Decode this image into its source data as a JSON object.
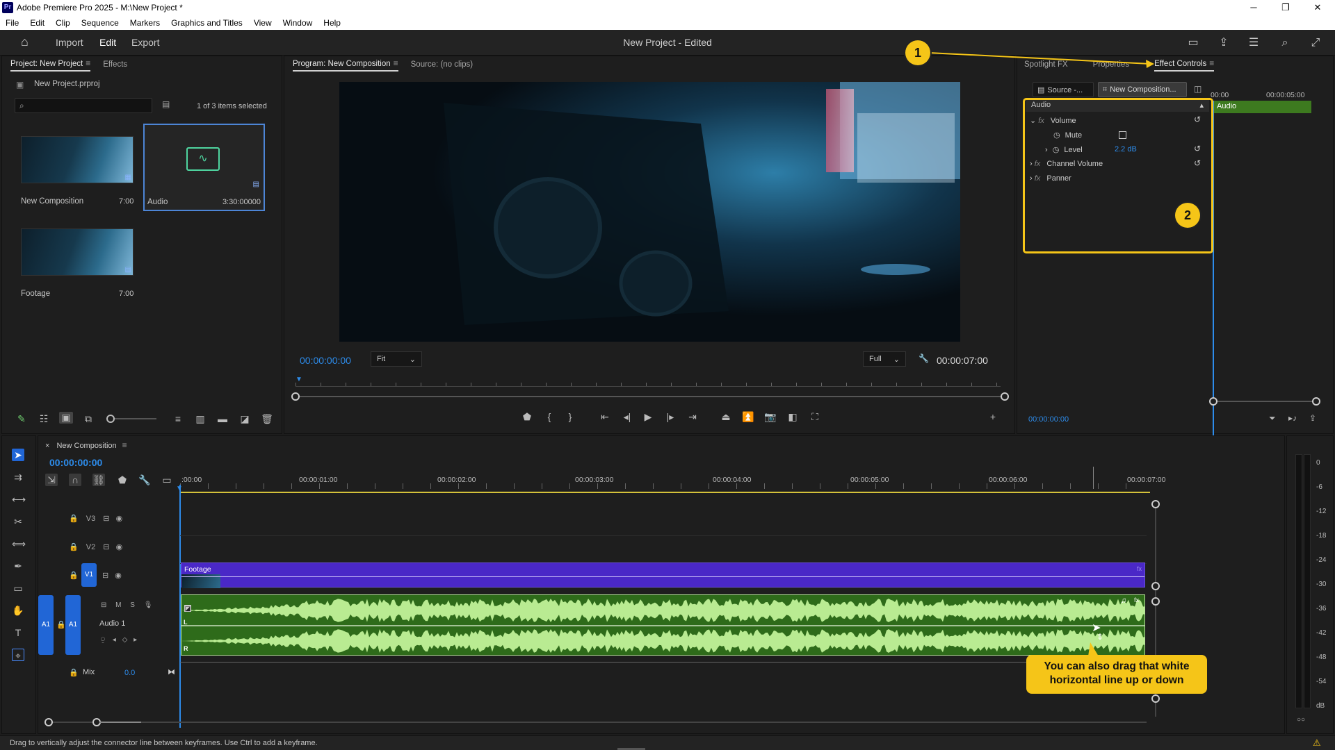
{
  "window": {
    "title": "Adobe Premiere Pro 2025 - M:\\New Project *",
    "app_icon": "Pr"
  },
  "menu": [
    "File",
    "Edit",
    "Clip",
    "Sequence",
    "Markers",
    "Graphics and Titles",
    "View",
    "Window",
    "Help"
  ],
  "header": {
    "nav": [
      "Import",
      "Edit",
      "Export"
    ],
    "active": "Edit",
    "project_title": "New Project - Edited"
  },
  "project_panel": {
    "tabs": [
      "Project: New Project",
      "Effects"
    ],
    "file": "New Project.prproj",
    "search_placeholder": "",
    "selection": "1 of 3 items selected",
    "items": [
      {
        "name": "New Composition",
        "duration": "7:00"
      },
      {
        "name": "Audio",
        "duration": "3:30:00000"
      },
      {
        "name": "Footage",
        "duration": "7:00"
      }
    ]
  },
  "program_monitor": {
    "tabs": [
      "Program: New Composition",
      "Source: (no clips)"
    ],
    "timecode": "00:00:00:00",
    "fit": "Fit",
    "quality": "Full",
    "duration": "00:00:07:00"
  },
  "effect_controls": {
    "tabs": [
      "Spotlight FX",
      "Properties",
      "Effect Controls"
    ],
    "source_btn": "Source -...",
    "seq_btn": "New Composition...",
    "timeline_marks": [
      "00:00",
      "00:00:05:00"
    ],
    "section": "Audio",
    "clip_label": "Audio",
    "effects": [
      {
        "name": "Volume",
        "fx": "fx"
      },
      {
        "name": "Mute"
      },
      {
        "name": "Level",
        "value": "2.2 dB"
      },
      {
        "name": "Channel Volume",
        "fx": "fx"
      },
      {
        "name": "Panner",
        "fx": "fx"
      }
    ],
    "timecode": "00:00:00:00"
  },
  "timeline": {
    "sequence": "New Composition",
    "timecode": "00:00:00:00",
    "ruler": [
      ":00:00",
      "00:00:01:00",
      "00:00:02:00",
      "00:00:03:00",
      "00:00:04:00",
      "00:00:05:00",
      "00:00:06:00",
      "00:00:07:00"
    ],
    "tracks": {
      "v3": "V3",
      "v2": "V2",
      "v1": "V1",
      "a1": "A1",
      "a1_name": "Audio 1",
      "mix": "Mix",
      "mix_value": "0.0",
      "m": "M",
      "s": "S",
      "l": "L",
      "r": "R"
    },
    "clips": {
      "video": "Footage"
    }
  },
  "meter": [
    "0",
    "-6",
    "-12",
    "-18",
    "-24",
    "-30",
    "-36",
    "-42",
    "-48",
    "-54",
    "dB"
  ],
  "meter_buttons": "○○",
  "callouts": {
    "one": "1",
    "two": "2",
    "text": "You can also drag that white horizontal line up or down"
  },
  "status": "Drag to vertically adjust the connector line between keyframes. Use Ctrl to add a keyframe.",
  "colors": {
    "accent": "#2d8ceb",
    "callout": "#f5c518",
    "video_clip": "#4a28c7",
    "audio_clip": "#9bd37a"
  }
}
